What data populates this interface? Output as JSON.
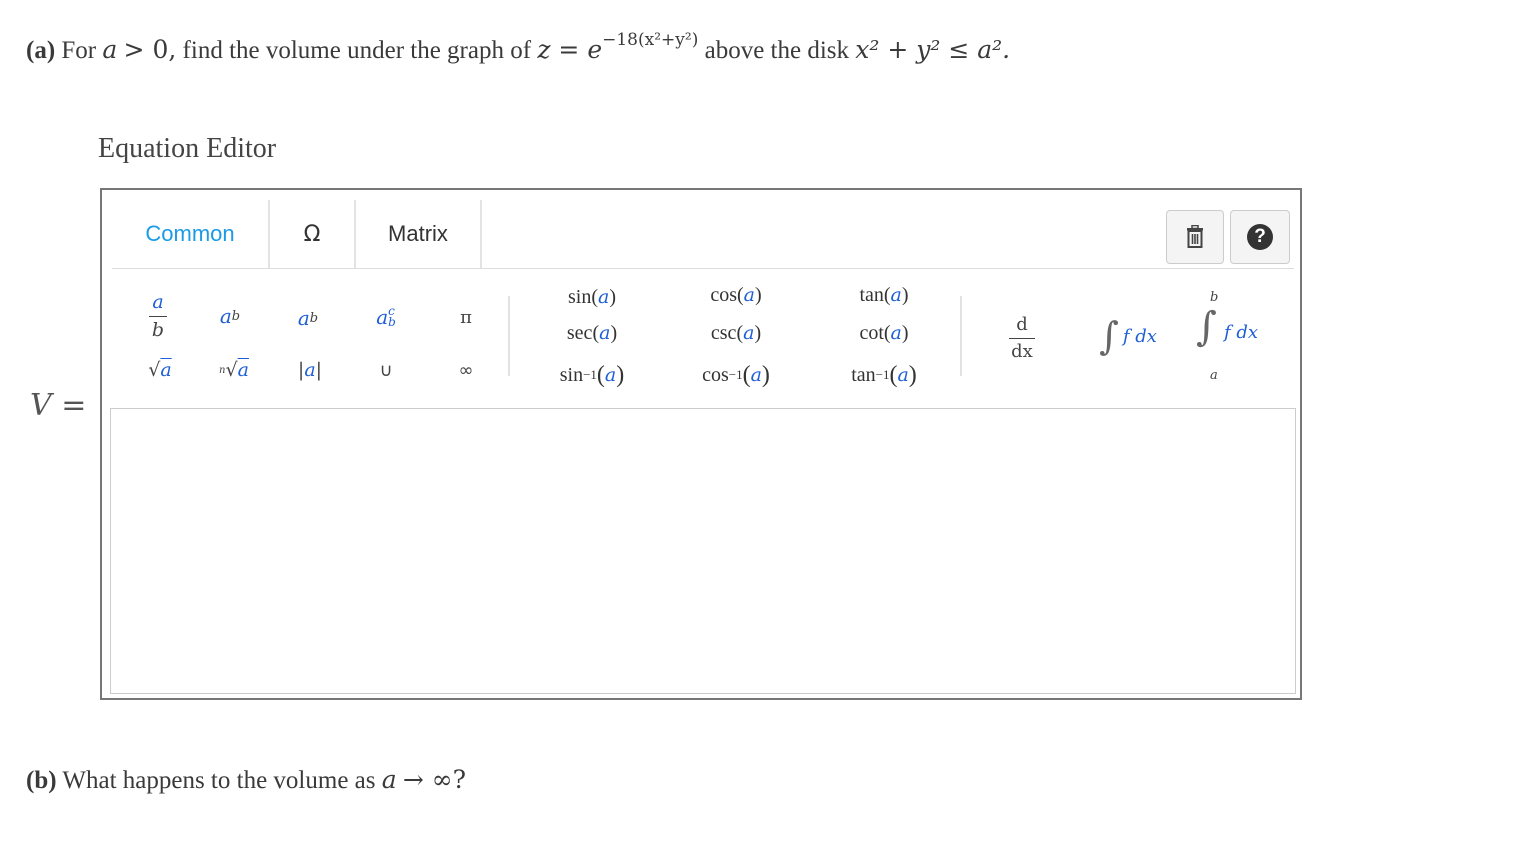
{
  "question_a": {
    "label": "(a)",
    "text1": "For",
    "a_var": "a",
    "gt_zero": "> 0,",
    "text2": "find the volume under the graph of",
    "z_eq": "z = e",
    "exponent": "−18(x²+y²)",
    "text3": "above the disk",
    "disk_ineq": "x² + y² ≤ a².",
    "disk_lhs": "x",
    "disk_mid": "+ y",
    "disk_le": "≤ a",
    "disk_end": "."
  },
  "editor": {
    "title": "Equation Editor",
    "tabs": [
      "Common",
      "Ω",
      "Matrix"
    ],
    "active_tab": "Common",
    "trash_icon": "trash-icon",
    "help_label": "?",
    "palette": {
      "frac_num": "a",
      "frac_den": "b",
      "pow_base": "a",
      "pow_exp": "b",
      "sub_base": "a",
      "sub_sub": "b",
      "supsub_base": "a",
      "supsub_sup": "c",
      "supsub_sub": "b",
      "pi": "π",
      "sqrt": "√a",
      "nroot_n": "n",
      "nroot": "√a",
      "abs": "|a|",
      "union": "∪",
      "infinity": "∞",
      "trig_row1": [
        "sin",
        "cos",
        "tan"
      ],
      "trig_row2": [
        "sec",
        "csc",
        "cot"
      ],
      "trig_row3": [
        "sin",
        "cos",
        "tan"
      ],
      "trig_arg": "a",
      "inverse_sup": "−1",
      "deriv_num": "d",
      "deriv_den": "dx",
      "integral": "∫",
      "integrand": "f dx",
      "def_int_upper": "b",
      "def_int_lower": "a"
    }
  },
  "answer": {
    "label_var": "V",
    "label_eq": " =",
    "value": ""
  },
  "question_b": {
    "label": "(b)",
    "text1": "What happens to the volume as",
    "a_var": "a",
    "limit": "→ ∞?"
  }
}
